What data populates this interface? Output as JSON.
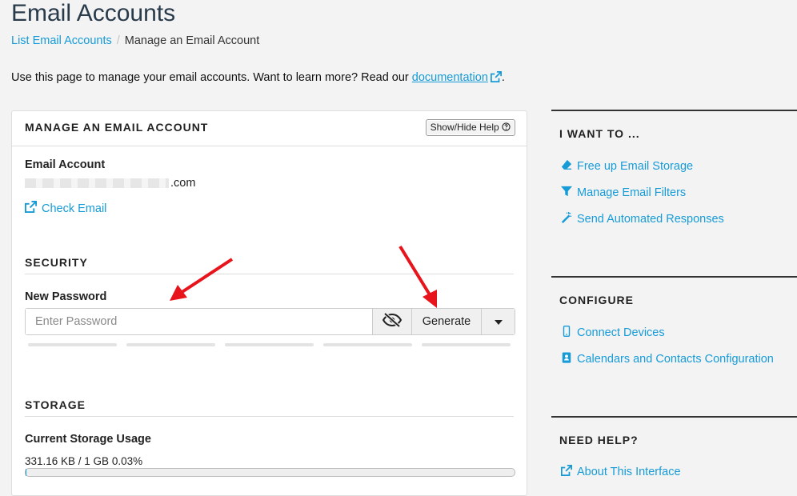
{
  "page": {
    "title": "Email Accounts",
    "breadcrumb": {
      "parent": "List Email Accounts",
      "separator": "/",
      "current": "Manage an Email Account"
    },
    "intro_text": "Use this page to manage your email accounts. Want to learn more? Read our ",
    "intro_link": "documentation",
    "intro_end": "."
  },
  "panel": {
    "title": "MANAGE AN EMAIL ACCOUNT",
    "help_button": "Show/Hide Help",
    "email_label": "Email Account",
    "email_value": ".com",
    "check_email": "Check Email",
    "security_title": "SECURITY",
    "new_password_label": "New Password",
    "password_placeholder": "Enter Password",
    "generate_label": "Generate",
    "storage_title": "STORAGE",
    "storage_usage_label": "Current Storage Usage",
    "storage_usage_value": "331.16 KB / 1 GB 0.03%",
    "storage_usage_fraction": 0.0003
  },
  "sidebar": {
    "sections": [
      {
        "title": "I WANT TO ...",
        "links": [
          "Free up Email Storage",
          "Manage Email Filters",
          "Send Automated Responses"
        ]
      },
      {
        "title": "CONFIGURE",
        "links": [
          "Connect Devices",
          "Calendars and Contacts Configuration"
        ]
      },
      {
        "title": "NEED HELP?",
        "links": [
          "About This Interface"
        ]
      }
    ]
  },
  "colors": {
    "link": "#179bd7",
    "annotation_arrow": "#e8141c"
  }
}
